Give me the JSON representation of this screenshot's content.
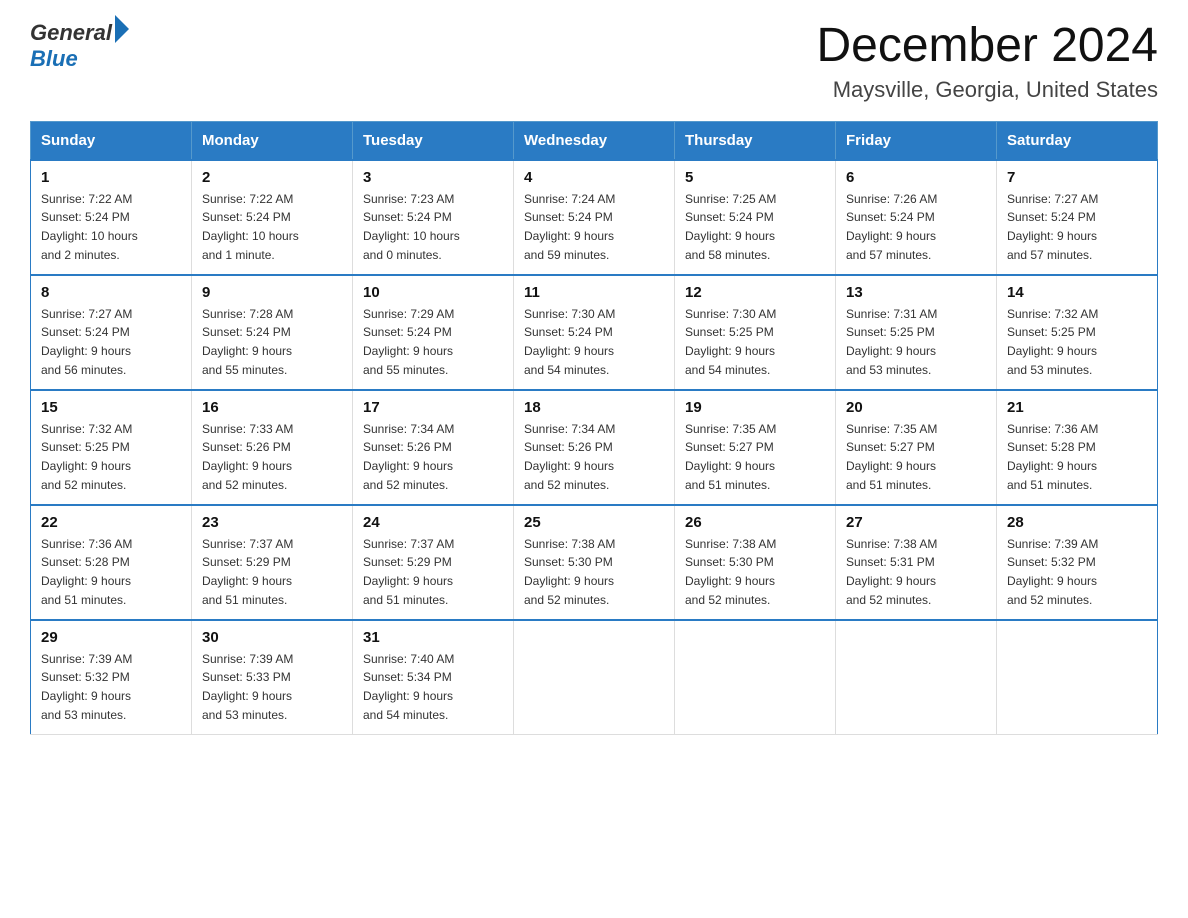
{
  "header": {
    "logo": {
      "text_general": "General",
      "text_blue": "Blue",
      "alt": "GeneralBlue logo"
    },
    "title": "December 2024",
    "subtitle": "Maysville, Georgia, United States"
  },
  "calendar": {
    "days_of_week": [
      "Sunday",
      "Monday",
      "Tuesday",
      "Wednesday",
      "Thursday",
      "Friday",
      "Saturday"
    ],
    "weeks": [
      [
        {
          "day": "1",
          "sunrise": "7:22 AM",
          "sunset": "5:24 PM",
          "daylight": "10 hours and 2 minutes."
        },
        {
          "day": "2",
          "sunrise": "7:22 AM",
          "sunset": "5:24 PM",
          "daylight": "10 hours and 1 minute."
        },
        {
          "day": "3",
          "sunrise": "7:23 AM",
          "sunset": "5:24 PM",
          "daylight": "10 hours and 0 minutes."
        },
        {
          "day": "4",
          "sunrise": "7:24 AM",
          "sunset": "5:24 PM",
          "daylight": "9 hours and 59 minutes."
        },
        {
          "day": "5",
          "sunrise": "7:25 AM",
          "sunset": "5:24 PM",
          "daylight": "9 hours and 58 minutes."
        },
        {
          "day": "6",
          "sunrise": "7:26 AM",
          "sunset": "5:24 PM",
          "daylight": "9 hours and 57 minutes."
        },
        {
          "day": "7",
          "sunrise": "7:27 AM",
          "sunset": "5:24 PM",
          "daylight": "9 hours and 57 minutes."
        }
      ],
      [
        {
          "day": "8",
          "sunrise": "7:27 AM",
          "sunset": "5:24 PM",
          "daylight": "9 hours and 56 minutes."
        },
        {
          "day": "9",
          "sunrise": "7:28 AM",
          "sunset": "5:24 PM",
          "daylight": "9 hours and 55 minutes."
        },
        {
          "day": "10",
          "sunrise": "7:29 AM",
          "sunset": "5:24 PM",
          "daylight": "9 hours and 55 minutes."
        },
        {
          "day": "11",
          "sunrise": "7:30 AM",
          "sunset": "5:24 PM",
          "daylight": "9 hours and 54 minutes."
        },
        {
          "day": "12",
          "sunrise": "7:30 AM",
          "sunset": "5:25 PM",
          "daylight": "9 hours and 54 minutes."
        },
        {
          "day": "13",
          "sunrise": "7:31 AM",
          "sunset": "5:25 PM",
          "daylight": "9 hours and 53 minutes."
        },
        {
          "day": "14",
          "sunrise": "7:32 AM",
          "sunset": "5:25 PM",
          "daylight": "9 hours and 53 minutes."
        }
      ],
      [
        {
          "day": "15",
          "sunrise": "7:32 AM",
          "sunset": "5:25 PM",
          "daylight": "9 hours and 52 minutes."
        },
        {
          "day": "16",
          "sunrise": "7:33 AM",
          "sunset": "5:26 PM",
          "daylight": "9 hours and 52 minutes."
        },
        {
          "day": "17",
          "sunrise": "7:34 AM",
          "sunset": "5:26 PM",
          "daylight": "9 hours and 52 minutes."
        },
        {
          "day": "18",
          "sunrise": "7:34 AM",
          "sunset": "5:26 PM",
          "daylight": "9 hours and 52 minutes."
        },
        {
          "day": "19",
          "sunrise": "7:35 AM",
          "sunset": "5:27 PM",
          "daylight": "9 hours and 51 minutes."
        },
        {
          "day": "20",
          "sunrise": "7:35 AM",
          "sunset": "5:27 PM",
          "daylight": "9 hours and 51 minutes."
        },
        {
          "day": "21",
          "sunrise": "7:36 AM",
          "sunset": "5:28 PM",
          "daylight": "9 hours and 51 minutes."
        }
      ],
      [
        {
          "day": "22",
          "sunrise": "7:36 AM",
          "sunset": "5:28 PM",
          "daylight": "9 hours and 51 minutes."
        },
        {
          "day": "23",
          "sunrise": "7:37 AM",
          "sunset": "5:29 PM",
          "daylight": "9 hours and 51 minutes."
        },
        {
          "day": "24",
          "sunrise": "7:37 AM",
          "sunset": "5:29 PM",
          "daylight": "9 hours and 51 minutes."
        },
        {
          "day": "25",
          "sunrise": "7:38 AM",
          "sunset": "5:30 PM",
          "daylight": "9 hours and 52 minutes."
        },
        {
          "day": "26",
          "sunrise": "7:38 AM",
          "sunset": "5:30 PM",
          "daylight": "9 hours and 52 minutes."
        },
        {
          "day": "27",
          "sunrise": "7:38 AM",
          "sunset": "5:31 PM",
          "daylight": "9 hours and 52 minutes."
        },
        {
          "day": "28",
          "sunrise": "7:39 AM",
          "sunset": "5:32 PM",
          "daylight": "9 hours and 52 minutes."
        }
      ],
      [
        {
          "day": "29",
          "sunrise": "7:39 AM",
          "sunset": "5:32 PM",
          "daylight": "9 hours and 53 minutes."
        },
        {
          "day": "30",
          "sunrise": "7:39 AM",
          "sunset": "5:33 PM",
          "daylight": "9 hours and 53 minutes."
        },
        {
          "day": "31",
          "sunrise": "7:40 AM",
          "sunset": "5:34 PM",
          "daylight": "9 hours and 54 minutes."
        },
        null,
        null,
        null,
        null
      ]
    ],
    "labels": {
      "sunrise_prefix": "Sunrise: ",
      "sunset_prefix": "Sunset: ",
      "daylight_prefix": "Daylight: "
    }
  }
}
